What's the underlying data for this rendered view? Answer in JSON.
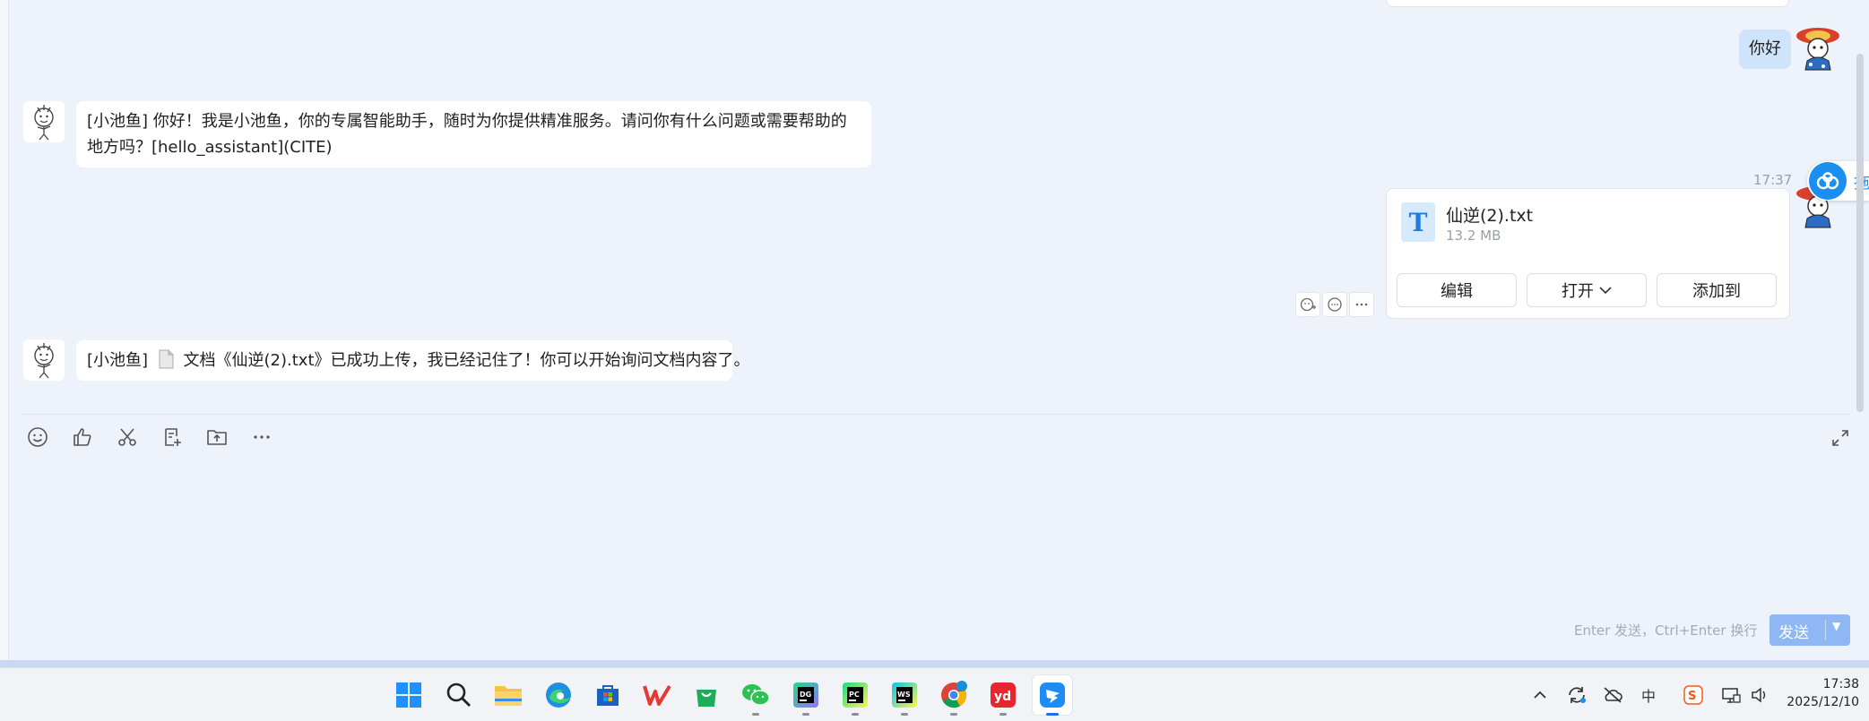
{
  "chat": {
    "messages": {
      "user_greeting": "你好",
      "bot_hello": "[小池鱼] 你好！我是小池鱼，你的专属智能助手，随时为你提供精准服务。请问你有什么问题或需要帮助的地方吗？[hello_assistant](CITE)",
      "file_timestamp": "17:37",
      "bot_upload_prefix": "[小池鱼]",
      "bot_upload_text": "文档《仙逆(2).txt》已成功上传，我已经记住了！你可以开始询问文档内容了。"
    },
    "file_card": {
      "icon_letter": "T",
      "name": "仙逆(2).txt",
      "size": "13.2 MB",
      "buttons": {
        "edit": "编辑",
        "open": "打开",
        "add_to": "添加到"
      }
    },
    "floating_badge": "拖"
  },
  "input": {
    "hint": "Enter 发送，Ctrl+Enter 换行",
    "send_label": "发送"
  },
  "toolbar_icons": [
    "emoji-icon",
    "thumbs-up-icon",
    "scissors-icon",
    "note-add-icon",
    "folder-upload-icon",
    "more-icon"
  ],
  "taskbar": {
    "apps": [
      "windows-start",
      "search",
      "file-explorer",
      "edge",
      "store",
      "wps",
      "app-store-bag",
      "wechat",
      "datagrip",
      "pycharm",
      "webstorm",
      "chrome",
      "youdao",
      "dingtalk"
    ],
    "tray_ime": "中",
    "time": "17:38",
    "date": "2025/12/10"
  },
  "colors": {
    "accent_blue": "#1a8ff0",
    "send_button": "#8eb7f4",
    "user_bubble": "#cfe4fb",
    "chat_bg": "#eef2fa"
  }
}
